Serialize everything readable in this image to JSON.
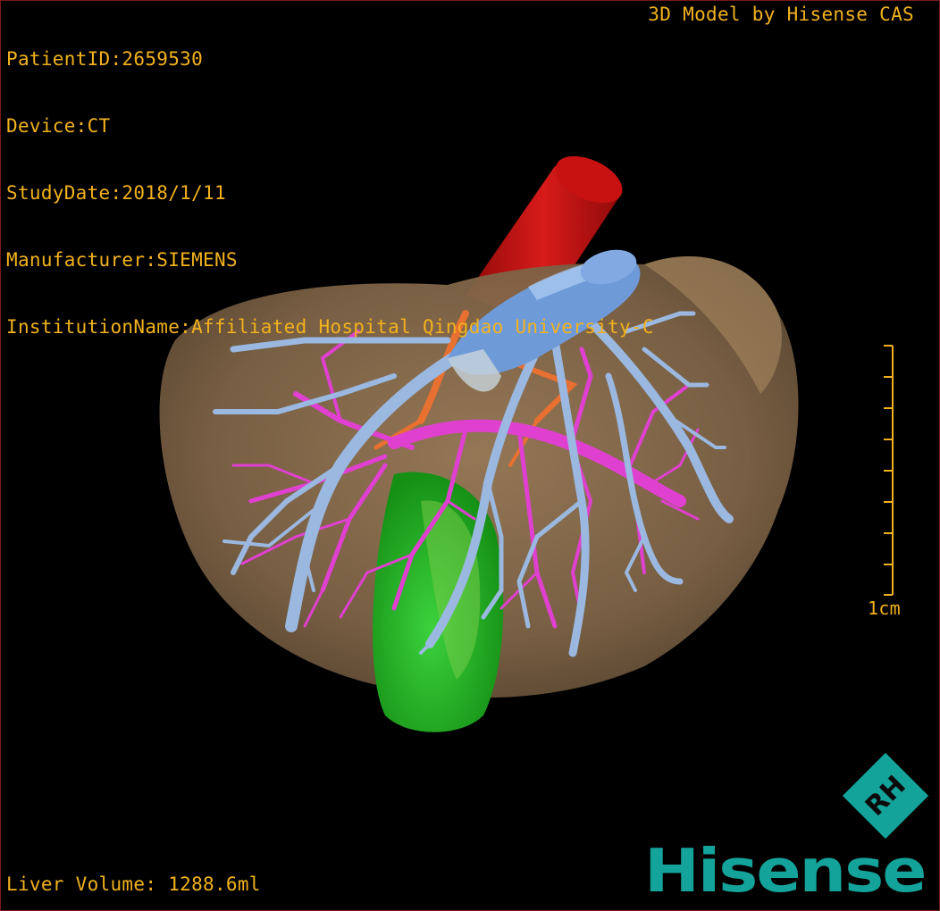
{
  "viewer": {
    "info_lines": [
      "PatientID:2659530",
      "Device:CT",
      "StudyDate:2018/1/11",
      "Manufacturer:SIEMENS",
      "InstitutionName:Affiliated Hospital Qingdao University-C"
    ],
    "credit": "3D Model by Hisense CAS",
    "liver_volume": "Liver Volume: 1288.6ml",
    "scale_label": "1cm"
  },
  "brand": {
    "logo_letters": "RH",
    "name": "Hisense"
  },
  "colors": {
    "overlay_text": "#f2b21d",
    "liver": "#8b6e4e",
    "artery": "#c01010",
    "portal_vein": "#e040d0",
    "hepatic_vein": "#9ab8e0",
    "gallbladder": "#22b822",
    "bile_duct": "#e87030",
    "brand": "#14a39a"
  }
}
